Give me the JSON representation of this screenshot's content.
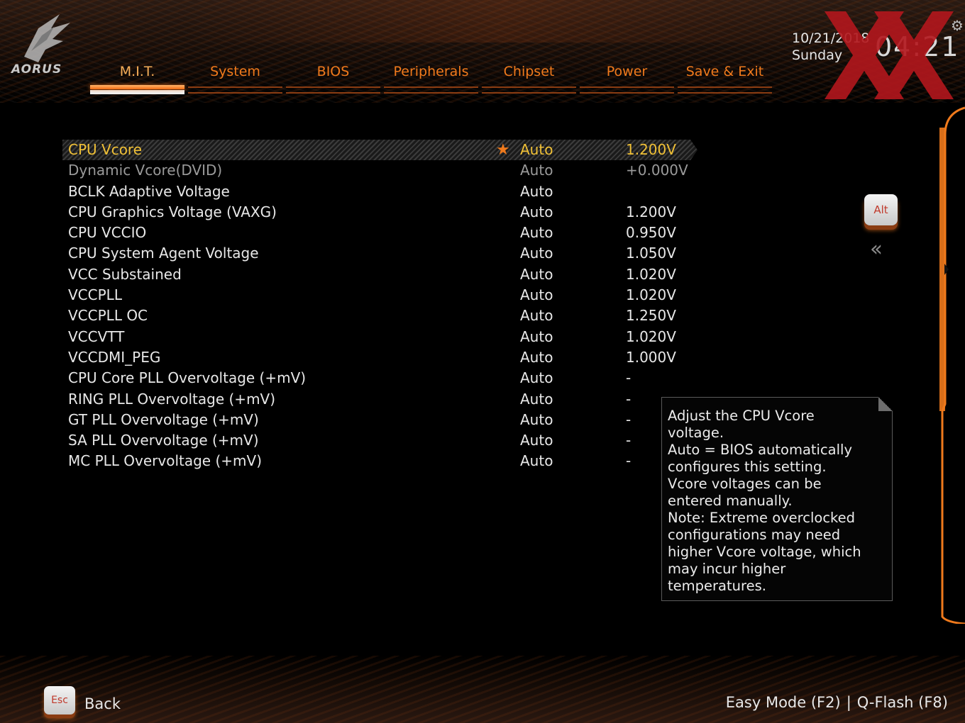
{
  "brand": {
    "logo_text": "AORUS"
  },
  "tabs": [
    {
      "label": "M.I.T.",
      "active": true
    },
    {
      "label": "System"
    },
    {
      "label": "BIOS"
    },
    {
      "label": "Peripherals"
    },
    {
      "label": "Chipset"
    },
    {
      "label": "Power"
    },
    {
      "label": "Save & Exit"
    }
  ],
  "clock": {
    "date": "10/21/2018",
    "day": "Sunday",
    "time": "04:21"
  },
  "settings": [
    {
      "label": "CPU Vcore",
      "mode": "Auto",
      "value": "1.200V",
      "state": "selected",
      "favorite": true
    },
    {
      "label": "Dynamic Vcore(DVID)",
      "mode": "Auto",
      "value": "+0.000V",
      "state": "dim"
    },
    {
      "label": "BCLK Adaptive Voltage",
      "mode": "Auto",
      "value": ""
    },
    {
      "label": "CPU Graphics Voltage (VAXG)",
      "mode": "Auto",
      "value": "1.200V"
    },
    {
      "label": "CPU VCCIO",
      "mode": "Auto",
      "value": "0.950V"
    },
    {
      "label": "CPU System Agent Voltage",
      "mode": "Auto",
      "value": "1.050V"
    },
    {
      "label": "VCC Substained",
      "mode": "Auto",
      "value": "1.020V"
    },
    {
      "label": "VCCPLL",
      "mode": "Auto",
      "value": "1.020V"
    },
    {
      "label": "VCCPLL OC",
      "mode": "Auto",
      "value": "1.250V"
    },
    {
      "label": "VCCVTT",
      "mode": "Auto",
      "value": "1.020V"
    },
    {
      "label": "VCCDMI_PEG",
      "mode": "Auto",
      "value": "1.000V"
    },
    {
      "label": "CPU Core PLL Overvoltage (+mV)",
      "mode": "Auto",
      "value": "-"
    },
    {
      "label": "RING PLL Overvoltage (+mV)",
      "mode": "Auto",
      "value": "-"
    },
    {
      "label": "GT PLL Overvoltage (+mV)",
      "mode": "Auto",
      "value": "-"
    },
    {
      "label": "SA PLL Overvoltage (+mV)",
      "mode": "Auto",
      "value": "-"
    },
    {
      "label": "MC PLL Overvoltage (+mV)",
      "mode": "Auto",
      "value": "-"
    }
  ],
  "side": {
    "alt_label": "Alt",
    "collapse_icon": "double-chevron-left-icon"
  },
  "help": {
    "text": "Adjust the CPU Vcore\nvoltage.\nAuto = BIOS automatically\nconfigures this setting.\nVcore voltages can be\nentered manually.\nNote: Extreme overclocked\nconfigurations may need\nhigher Vcore voltage, which\nmay incur higher\ntemperatures."
  },
  "footer": {
    "esc_label": "Esc",
    "back_label": "Back",
    "easy_mode": "Easy Mode (F2)",
    "separator": "|",
    "qflash": "Q-Flash (F8)"
  },
  "colors": {
    "accent": "#f07a1c",
    "selected_text": "#f0c036",
    "watermark": "#b3171d"
  }
}
